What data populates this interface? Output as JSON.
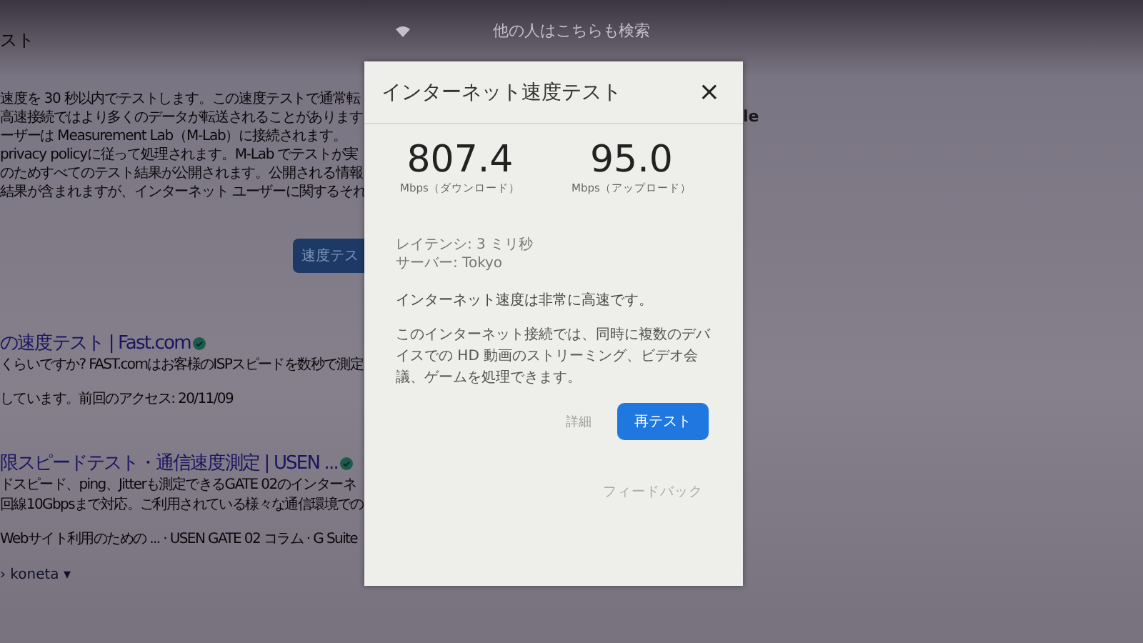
{
  "background_page": {
    "heading": "スト",
    "paragraphs": [
      "速度を 30 秒以内でテストします。この速度テストで通常転",
      "高速接続ではより多くのデータが転送されることがあります",
      "ーザーは Measurement Lab（M-Lab）に接続されます。",
      "privacy policyに従って処理されます。M-Lab でテストが実",
      "のためすべてのテスト結果が公開されます。公開される情報",
      "結果が含まれますが、インターネット ユーザーに関するそれ"
    ],
    "button": "速度テス",
    "results": [
      {
        "title": "の速度テスト | Fast.com",
        "lines": [
          "くらいですか? FAST.comはお客様のISPスピードを数秒で測定",
          "しています。前回のアクセス: 20/11/09"
        ]
      },
      {
        "title": "限スピードテスト・通信速度測定 | USEN ...",
        "lines": [
          "ドスピード、ping、Jitterも測定できるGATE 02のインターネ",
          "回線10Gbpsまで対応。ご利用されている様々な通信環境での",
          "Webサイト利用のための ... · USEN GATE 02 コラム · G Suite"
        ]
      }
    ],
    "breadcrumb": "› koneta ▾",
    "related_heading": "他の人はこちらも検索",
    "right_fragment": "le"
  },
  "dialog": {
    "title": "インターネット速度テスト",
    "close": "×",
    "speeds": [
      {
        "value": "807.4",
        "label": "Mbps（ダウンロード）"
      },
      {
        "value": "95.0",
        "label": "Mbps（アップロード）"
      }
    ],
    "details": [
      "レイテンシ: 3 ミリ秒",
      "サーバー: Tokyo"
    ],
    "verdict": "インターネット速度は非常に高速です。",
    "description": "このインターネット接続では、同時に複数のデバイスでの HD 動画のストリーミング、ビデオ会議、ゲームを処理できます。",
    "details_link": "詳細",
    "retest_button": "再テスト",
    "feedback_link": "フィードバック"
  }
}
